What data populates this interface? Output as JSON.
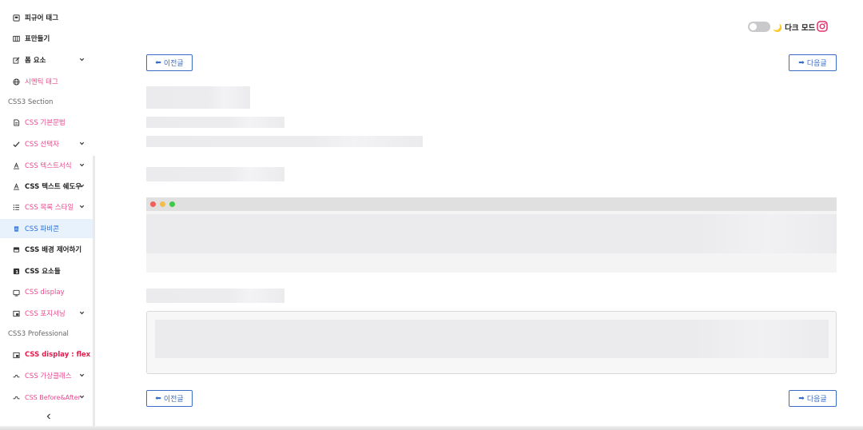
{
  "sidebar": {
    "items": [
      {
        "label": "피규어 태그",
        "icon": "figure-icon"
      },
      {
        "label": "표만들기",
        "icon": "table-icon"
      },
      {
        "label": "폼 요소",
        "icon": "form-edit-icon"
      },
      {
        "label": "시멘틱 태그",
        "icon": "globe-icon"
      },
      {
        "label": "CSS 기본문법",
        "icon": "document-icon"
      },
      {
        "label": "CSS 선택자",
        "icon": "check-icon"
      },
      {
        "label": "CSS 텍스트서식",
        "icon": "text-format-icon"
      },
      {
        "label": "CSS 텍스트 쉐도우",
        "icon": "text-shadow-icon"
      },
      {
        "label": "CSS 목록 스타일",
        "icon": "list-icon"
      },
      {
        "label": "CSS 파비콘",
        "icon": "favicon-icon"
      },
      {
        "label": "CSS 배경 제어하기",
        "icon": "background-icon"
      },
      {
        "label": "CSS 요소들",
        "icon": "element-icon"
      },
      {
        "label": "CSS display",
        "icon": "display-icon"
      },
      {
        "label": "CSS 포지셔닝",
        "icon": "position-icon"
      },
      {
        "label": "CSS display : flex",
        "icon": "flex-icon"
      },
      {
        "label": "CSS 가상클래스",
        "icon": "pseudo-class-icon"
      },
      {
        "label": "CSS Before&After",
        "icon": "before-after-icon"
      }
    ],
    "sections": {
      "css3": "CSS3 Section",
      "professional": "CSS3 Professional"
    }
  },
  "header": {
    "dark_mode_label": "🌙 다크 모드",
    "dark_mode_on": false
  },
  "pager": {
    "prev_label": "이전글",
    "next_label": "다음글"
  },
  "colors": {
    "accent_blue": "#3b6cc4",
    "link_pink": "#e64a8c",
    "link_red": "#e6194b",
    "active_bg": "#e8f2fd",
    "instagram": "#e1306c"
  }
}
